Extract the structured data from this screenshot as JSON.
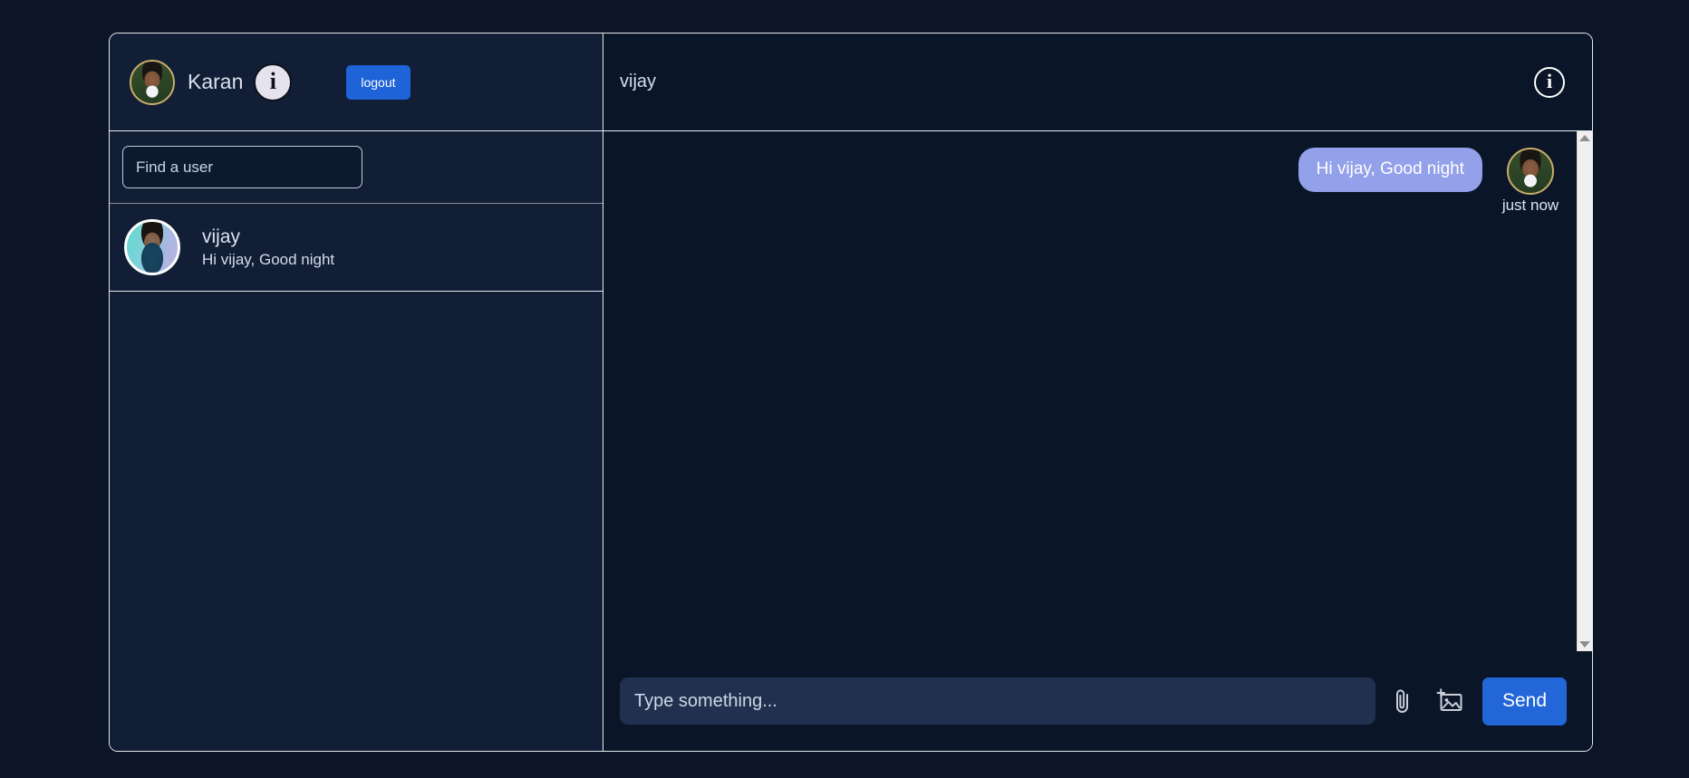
{
  "window": {
    "sidebar": {
      "header": {
        "avatar_name": "user-avatar-karan",
        "username": "Karan",
        "info_icon_glyph": "i",
        "logout_label": "logout"
      },
      "search": {
        "placeholder": "Find a user",
        "value": ""
      },
      "conversations": [
        {
          "name": "vijay",
          "preview": "Hi vijay, Good night",
          "avatar_name": "user-avatar-vijay"
        }
      ]
    },
    "chat": {
      "header": {
        "title": "vijay",
        "info_icon_glyph": "i"
      },
      "messages": [
        {
          "text": "Hi vijay, Good night",
          "time": "just now",
          "direction": "outgoing",
          "avatar_name": "user-avatar-karan"
        }
      ],
      "composer": {
        "placeholder": "Type something...",
        "value": "",
        "attach_icon": "paperclip-icon",
        "image_icon": "add-image-icon",
        "send_label": "Send"
      },
      "scrollbar": {
        "up_arrow": "scroll-up-arrow",
        "down_arrow": "scroll-down-arrow"
      }
    }
  },
  "colors": {
    "page_background": "#0b1526",
    "sidebar_background": "#111e36",
    "chat_background": "#0a1628",
    "accent_blue": "#2366d8",
    "logout_blue": "#1f63d8",
    "bubble_outgoing": "#93a0ea",
    "input_background": "#22304f",
    "border_light": "#e8eaef",
    "text_primary": "#d8e2ee"
  }
}
